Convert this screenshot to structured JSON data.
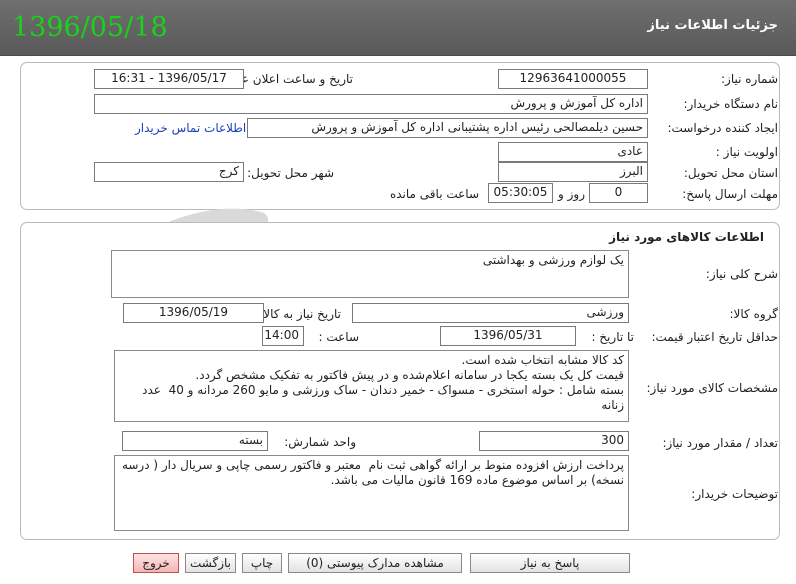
{
  "header": {
    "title": "جزئیات اطلاعات نیاز",
    "date_stamp": "1396/05/18"
  },
  "need": {
    "number_label": "شماره نیاز:",
    "number_value": "12963641000055",
    "announce_label": "تاریخ و ساعت اعلان عمومی:",
    "announce_value": "1396/05/17 - 16:31",
    "buyer_label": "نام دستگاه خریدار:",
    "buyer_value": "اداره کل آموزش و پرورش",
    "requester_label": "ایجاد کننده درخواست:",
    "requester_value": "حسین دیلمصالحی رئیس اداره پشتیبانی اداره کل آموزش و پرورش",
    "contact_link": "اطلاعات تماس خریدار",
    "priority_label": "اولویت نیاز :",
    "priority_value": "عادی",
    "province_label": "استان محل تحویل:",
    "province_value": "البرز",
    "city_label": "شهر محل تحویل:",
    "city_value": "کرج",
    "deadline_label": "مهلت ارسال پاسخ:",
    "deadline_days": "0",
    "deadline_days_unit": "روز و",
    "deadline_time": "05:30:05",
    "deadline_time_unit": "ساعت باقی مانده"
  },
  "goods": {
    "section_title": "اطلاعات کالاهای مورد نیاز",
    "summary_label": "شرح کلی نیاز:",
    "summary_value": "یک لوازم ورزشی و بهداشتی",
    "group_label": "گروه کالا:",
    "group_value": "ورزشی",
    "need_date_label": "تاریخ نیاز به کالا:",
    "need_date_value": "1396/05/19",
    "validity_label": "حداقل تاریخ اعتبار قیمت:",
    "until_date_label": "تا تاریخ :",
    "until_date_value": "1396/05/31",
    "hour_label": "ساعت :",
    "hour_value": "14:00",
    "specs_label": "مشخصات کالای مورد نیاز:",
    "specs_value": "کد کالا مشابه انتخاب شده است.\nقیمت کل یک بسته یکجا در سامانه اعلام‌شده و در پیش فاکتور به تفکیک مشخص گردد.\nبسته شامل : حوله استخری - مسواک - خمیر دندان - ساک ورزشی و مایو 260 مردانه و 40  عدد زنانه",
    "qty_label": "تعداد / مقدار مورد نیاز:",
    "qty_value": "300",
    "unit_label": "واحد شمارش:",
    "unit_value": "بسته",
    "buyer_notes_label": "توضیحات خریدار:",
    "buyer_notes_value": "پرداخت ارزش افزوده منوط بر ارائه گواهی ثبت نام  معتبر و فاکتور رسمی چاپی و سریال دار ( درسه نسخه) بر اساس موضوع ماده 169 قانون مالیات می باشد."
  },
  "actions": {
    "reply": "پاسخ به نیاز",
    "attachments": "مشاهده مدارک پیوستی (0)",
    "print": "چاپ",
    "back": "بازگشت",
    "exit": "خروج"
  },
  "colors": {
    "header_bg": "#636363",
    "date_stamp": "#19d219",
    "link": "#1a3fbf",
    "exit_button": "#f4b5b5"
  }
}
